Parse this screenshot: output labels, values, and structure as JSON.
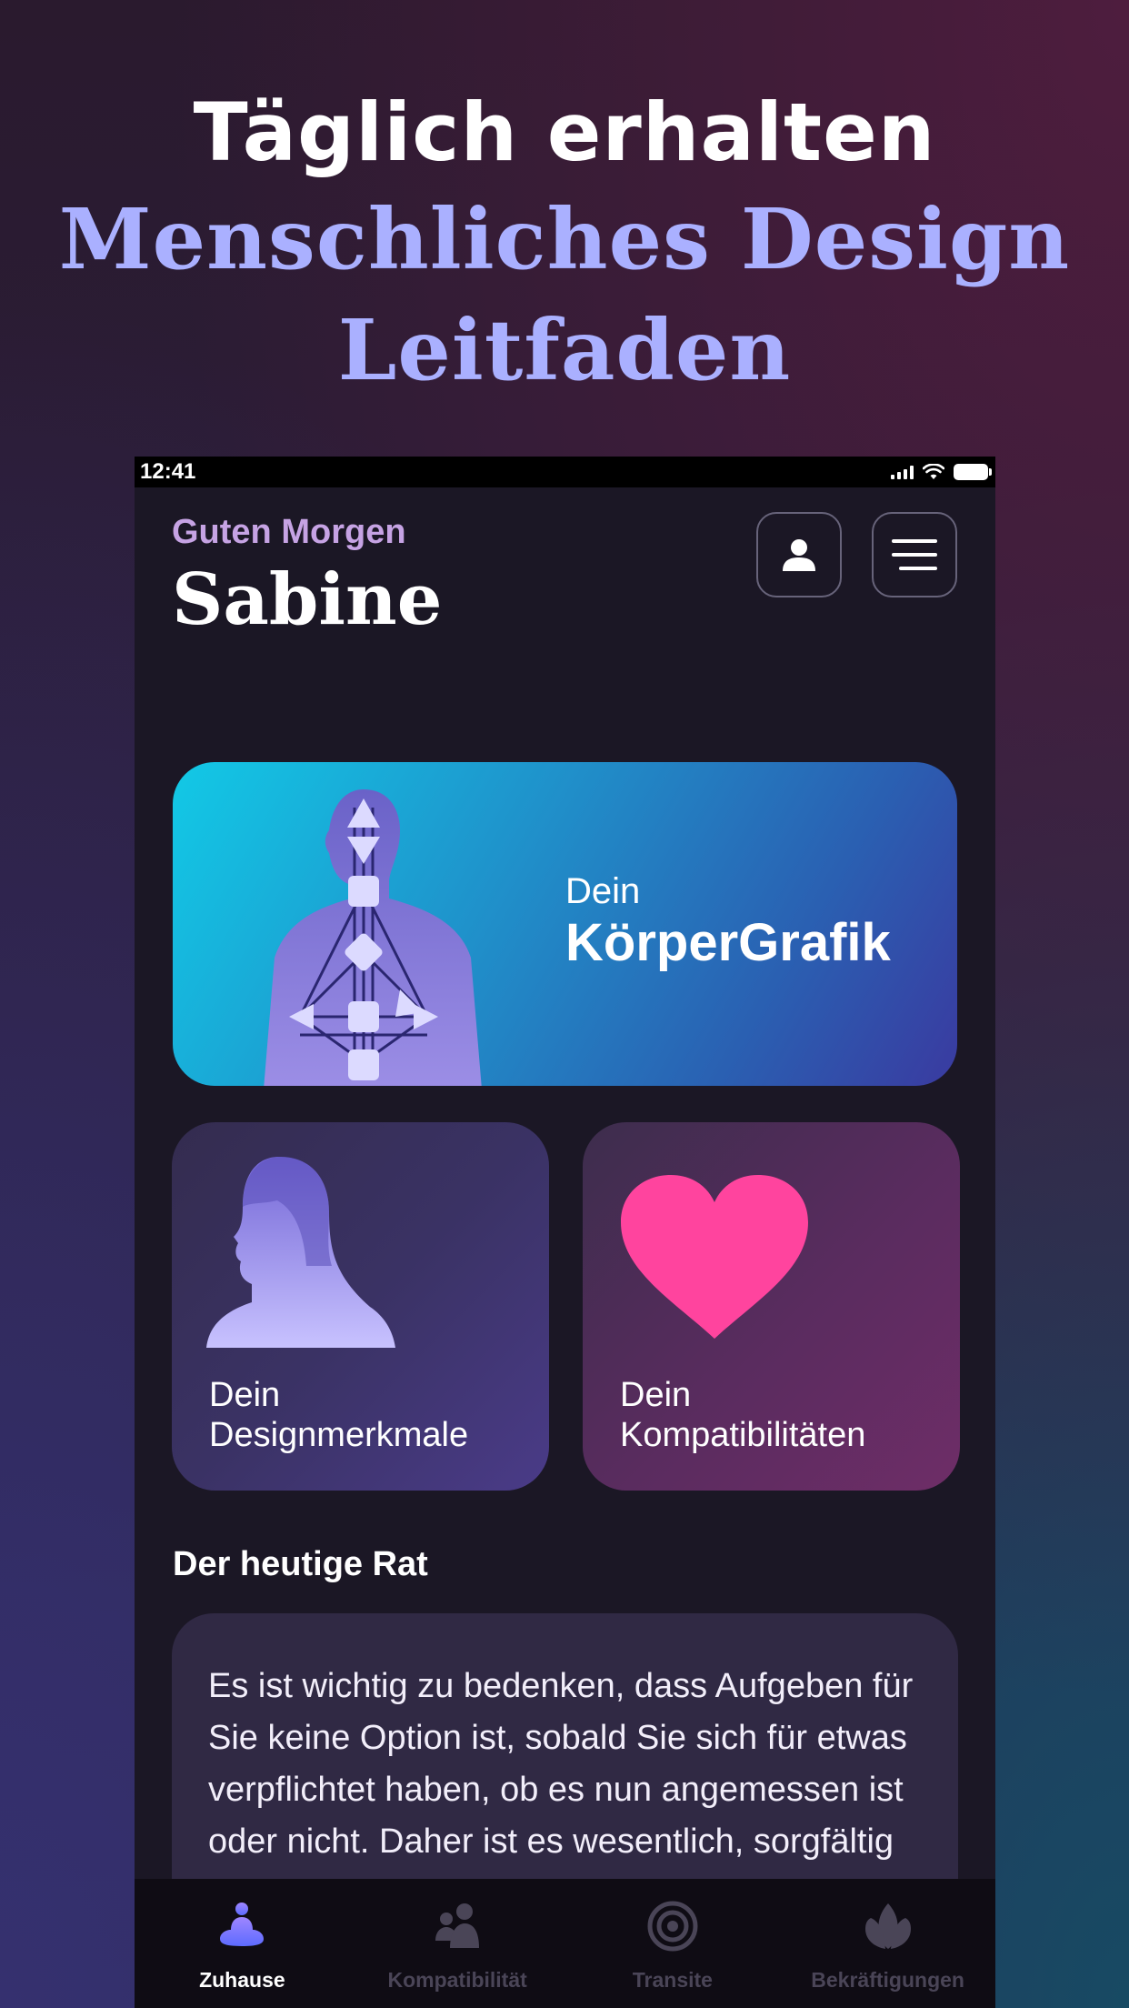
{
  "headline": {
    "line1": "Täglich erhalten",
    "line2": "Menschliches Design",
    "line3": "Leitfaden"
  },
  "status_bar": {
    "time": "12:41"
  },
  "header": {
    "greeting": "Guten Morgen",
    "name": "Sabine"
  },
  "body_card": {
    "line1": "Dein",
    "line2": "KörperGrafik"
  },
  "cards": [
    {
      "line1": "Dein",
      "line2": "Designmerkmale"
    },
    {
      "line1": "Dein",
      "line2": "Kompatibilitäten"
    }
  ],
  "advice": {
    "title": "Der heutige Rat",
    "text": "Es ist wichtig zu bedenken, dass Aufgeben für Sie keine Option ist, sobald Sie sich für etwas verpflichtet haben, ob es nun angemessen ist oder nicht. Daher ist es wesentlich, sorgfältig zu prüfen, auf welche Dinge Sie sich einlassen."
  },
  "tabs": [
    {
      "label": "Zuhause",
      "icon": "meditation-icon",
      "active": true
    },
    {
      "label": "Kompatibilität",
      "icon": "people-icon",
      "active": false
    },
    {
      "label": "Transite",
      "icon": "target-icon",
      "active": false
    },
    {
      "label": "Bekräftigungen",
      "icon": "lotus-icon",
      "active": false
    }
  ],
  "colors": {
    "accent": "#aab0ff",
    "heart": "#ff449e",
    "greeting": "#c6a3e4"
  }
}
